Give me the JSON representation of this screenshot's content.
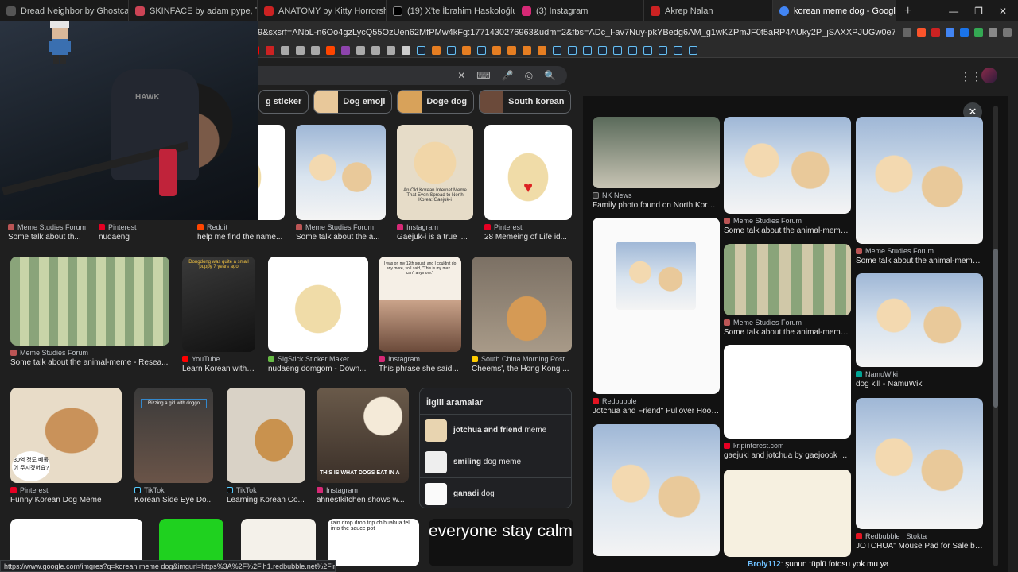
{
  "tabs": [
    {
      "title": "Dread Neighbor by Ghostcase001",
      "color": "#555"
    },
    {
      "title": "SKINFACE by adam pype, Ties Groen",
      "color": "#c45"
    },
    {
      "title": "ANATOMY by Kitty Horrorshow",
      "color": "#c22"
    },
    {
      "title": "(19) X'te İbrahim Haskoloğlu: \"🔴#S",
      "color": "#000"
    },
    {
      "title": "(3) Instagram",
      "color": "#d62976"
    },
    {
      "title": "Akrep Nalan",
      "color": "#c22"
    },
    {
      "title": "korean meme dog - Google'da",
      "color": "#4285f4",
      "active": true
    }
  ],
  "new_tab": "+",
  "url": "google.com/search?sca_esv=babc3dbce6714cb9&sxsrf=ANbL-n6Oo4gzLycQ55OzUen62MfPMw4kFg:1771430276963&udm=2&fbs=ADc_l-av7Nuy-pkYBedg6AM_g1wKZPmJF0t5aRP4AUky2P_jSAXXPJUGw0e79131b...",
  "chips": [
    {
      "label": "g sticker"
    },
    {
      "label": "Dog emoji"
    },
    {
      "label": "Doge dog"
    },
    {
      "label": "South korean"
    }
  ],
  "results": [
    {
      "source": "Meme Studies Forum",
      "title": "Some talk about th...",
      "favcolor": "#b55"
    },
    {
      "source": "Pinterest",
      "title": "nudaeng",
      "favcolor": "#e60023"
    },
    {
      "source": "Reddit",
      "title": "help me find the name...",
      "favcolor": "#ff4500"
    },
    {
      "source": "Meme Studies Forum",
      "title": "Some talk about the a...",
      "favcolor": "#b55"
    },
    {
      "source": "Instagram",
      "title": "Gaejuk-i is a true i...",
      "favcolor": "#d62976"
    },
    {
      "source": "Pinterest",
      "title": "28 Memeing of Life id...",
      "favcolor": "#e60023"
    },
    {
      "source": "Meme Studies Forum",
      "title": "Some talk about the animal-meme - Resea...",
      "favcolor": "#b55"
    },
    {
      "source": "YouTube",
      "title": "Learn Korean with ...",
      "favcolor": "#f00"
    },
    {
      "source": "SigStick Sticker Maker",
      "title": "nudaeng domgom - Down...",
      "favcolor": "#6b4"
    },
    {
      "source": "Instagram",
      "title": "This phrase she said...",
      "favcolor": "#d62976"
    },
    {
      "source": "South China Morning Post",
      "title": "Cheems', the Hong Kong ...",
      "favcolor": "#fc0"
    },
    {
      "source": "Pinterest",
      "title": "Funny Korean Dog Meme",
      "favcolor": "#e60023"
    },
    {
      "source": "TikTok",
      "title": "Korean Side Eye Do...",
      "favcolor": "#111"
    },
    {
      "source": "TikTok",
      "title": "Learning Korean Co...",
      "favcolor": "#111"
    },
    {
      "source": "Instagram",
      "title": "ahnestkitchen shows w...",
      "favcolor": "#d62976"
    }
  ],
  "image_texts": {
    "yt_overlay": "Dongdong was quite a small puppy 7 years ago",
    "ig_overlay": "I was on my 12th squat, and I couldn't do any more, so I said, \"This is my max. I can't anymore.\"",
    "korean_caption": "30억 정도 베풀어 주시겠어요?",
    "rizz_caption": "Rizzing a girl with doggo",
    "ig_food": "THIS IS WHAT DOGS EAT IN A",
    "bottom_text": "everyone stay calm",
    "instagram_text": "An Old Korean Internet Meme That Even Spread to North Korea: Gaejuk-i",
    "rain_text": "rain drop drop top chihuahua fell into the sauce pot"
  },
  "related": {
    "heading": "İlgili aramalar",
    "items": [
      {
        "bold": "jotchua and friend",
        "rest": " meme"
      },
      {
        "bold": "smiling",
        "rest": " dog meme"
      },
      {
        "bold": "ganadi",
        "rest": " dog"
      }
    ]
  },
  "panel": {
    "close": "✕",
    "items": [
      {
        "source": "NK News",
        "title": "Family photo found on North Korean...",
        "favcolor": "#333"
      },
      {
        "source": "Meme Studies Forum",
        "title": "Some talk about the animal-meme -...",
        "favcolor": "#b55"
      },
      {
        "source": "Meme Studies Forum",
        "title": "Some talk about the animal-meme -...",
        "favcolor": "#b55"
      },
      {
        "source": "Redbubble",
        "title": "Jotchua and Friend\" Pullover Hoodie fo...",
        "favcolor": "#e41321"
      },
      {
        "source": "Meme Studies Forum",
        "title": "Some talk about the animal-meme -...",
        "favcolor": "#b55"
      },
      {
        "source": "kr.pinterest.com",
        "title": "gaejuki and jotchua by gaejoook on...",
        "favcolor": "#e60023"
      },
      {
        "source": "NamuWiki",
        "title": "dog kill - NamuWiki",
        "favcolor": "#00a495"
      },
      {
        "source": "Redbubble · Stokta",
        "title": "JOTCHUA\" Mouse Pad for Sale by...",
        "favcolor": "#e41321"
      }
    ]
  },
  "chat": {
    "user": "Broly112",
    "message": ": şunun tüplü fotosu yok mu ya"
  },
  "status_url": "https://www.google.com/imgres?q=korean meme dog&imgurl=https%3A%2F%2Fih1.redbubble.net%2Fimage.2373..."
}
